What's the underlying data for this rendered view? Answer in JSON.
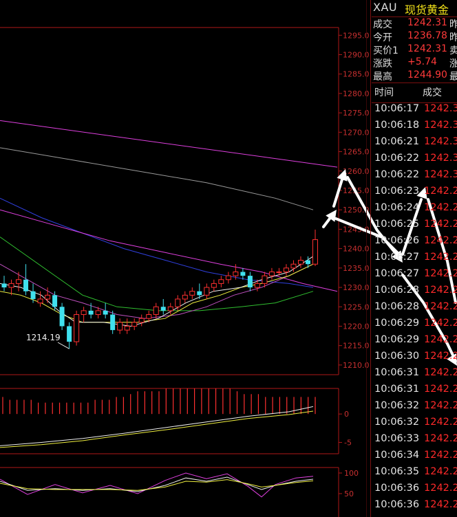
{
  "header": {
    "symbol": "XAU",
    "name": "现货黄金"
  },
  "quote": {
    "rows": [
      {
        "label": "成交",
        "value": "1242.31",
        "ext": "昨",
        "color": "#ff3a3a"
      },
      {
        "label": "今开",
        "value": "1236.78",
        "ext": "昨",
        "color": "#ff3a3a"
      },
      {
        "label": "买价1",
        "value": "1242.31",
        "ext": "卖",
        "color": "#ff3a3a"
      },
      {
        "label": "涨跌",
        "value": "+5.74",
        "ext": "涨",
        "color": "#ff3a3a"
      },
      {
        "label": "最高",
        "value": "1244.90",
        "ext": "最",
        "color": "#ff3a3a"
      }
    ]
  },
  "ticks": {
    "header_time": "时间",
    "header_price": "成交",
    "rows": [
      {
        "time": "10:06:17",
        "price": "1242.3"
      },
      {
        "time": "10:06:18",
        "price": "1242.3"
      },
      {
        "time": "10:06:21",
        "price": "1242.3"
      },
      {
        "time": "10:06:22",
        "price": "1242.3"
      },
      {
        "time": "10:06:22",
        "price": "1242.3"
      },
      {
        "time": "10:06:23",
        "price": "1242.2"
      },
      {
        "time": "10:06:24",
        "price": "1242.2"
      },
      {
        "time": "10:06:25",
        "price": "1242.2"
      },
      {
        "time": "10:06:26",
        "price": "1242.2"
      },
      {
        "time": "10:06:27",
        "price": "1242.2"
      },
      {
        "time": "10:06:27",
        "price": "1242.2"
      },
      {
        "time": "10:06:28",
        "price": "1242.2"
      },
      {
        "time": "10:06:28",
        "price": "1242.2"
      },
      {
        "time": "10:06:29",
        "price": "1242.2"
      },
      {
        "time": "10:06:29",
        "price": "1242.2"
      },
      {
        "time": "10:06:30",
        "price": "1242.2"
      },
      {
        "time": "10:06:31",
        "price": "1242.2"
      },
      {
        "time": "10:06:31",
        "price": "1242.2"
      },
      {
        "time": "10:06:32",
        "price": "1242.2"
      },
      {
        "time": "10:06:32",
        "price": "1242.2"
      },
      {
        "time": "10:06:33",
        "price": "1242.2"
      },
      {
        "time": "10:06:34",
        "price": "1242.2"
      },
      {
        "time": "10:06:35",
        "price": "1242.2"
      },
      {
        "time": "10:06:36",
        "price": "1242.2"
      },
      {
        "time": "10:06:36",
        "price": "1242.2"
      }
    ]
  },
  "chart_data": {
    "type": "candlestick",
    "title": "",
    "price_axis": {
      "ylim": [
        1207.5,
        1297.0
      ],
      "ticks": [
        "1295.0",
        "1290.0",
        "1285.0",
        "1280.0",
        "1275.0",
        "1270.0",
        "1265.0",
        "1260.0",
        "1255.0",
        "1250.0",
        "1245.0",
        "1240.0",
        "1235.0",
        "1230.0",
        "1225.0",
        "1220.0",
        "1215.0",
        "1210.0"
      ]
    },
    "colors": {
      "up": "#ff3030",
      "down": "#40e0ee",
      "axis": "#b01818",
      "label": "#c83030"
    },
    "low_label": "1214.19",
    "candles": [
      {
        "o": 1231,
        "h": 1233,
        "l": 1229,
        "c": 1230
      },
      {
        "o": 1230,
        "h": 1232,
        "l": 1228,
        "c": 1231
      },
      {
        "o": 1231,
        "h": 1234,
        "l": 1229,
        "c": 1232
      },
      {
        "o": 1232,
        "h": 1236,
        "l": 1228,
        "c": 1229
      },
      {
        "o": 1229,
        "h": 1231,
        "l": 1226,
        "c": 1227
      },
      {
        "o": 1226,
        "h": 1229,
        "l": 1225,
        "c": 1227
      },
      {
        "o": 1227,
        "h": 1230,
        "l": 1226,
        "c": 1228
      },
      {
        "o": 1228,
        "h": 1229,
        "l": 1224,
        "c": 1225
      },
      {
        "o": 1225,
        "h": 1226,
        "l": 1219,
        "c": 1220
      },
      {
        "o": 1220,
        "h": 1221,
        "l": 1214.19,
        "c": 1216
      },
      {
        "o": 1216,
        "h": 1224,
        "l": 1215,
        "c": 1223
      },
      {
        "o": 1223,
        "h": 1225,
        "l": 1221,
        "c": 1224
      },
      {
        "o": 1224,
        "h": 1226,
        "l": 1222,
        "c": 1223
      },
      {
        "o": 1223,
        "h": 1225,
        "l": 1222,
        "c": 1224
      },
      {
        "o": 1224,
        "h": 1226,
        "l": 1222,
        "c": 1223
      },
      {
        "o": 1223,
        "h": 1224,
        "l": 1218,
        "c": 1219
      },
      {
        "o": 1219,
        "h": 1222,
        "l": 1218,
        "c": 1221
      },
      {
        "o": 1219,
        "h": 1222,
        "l": 1218,
        "c": 1220
      },
      {
        "o": 1220,
        "h": 1222,
        "l": 1219,
        "c": 1221
      },
      {
        "o": 1221,
        "h": 1223,
        "l": 1220,
        "c": 1222
      },
      {
        "o": 1222,
        "h": 1224,
        "l": 1221,
        "c": 1223
      },
      {
        "o": 1223,
        "h": 1226,
        "l": 1222,
        "c": 1225
      },
      {
        "o": 1225,
        "h": 1227,
        "l": 1223,
        "c": 1224
      },
      {
        "o": 1224,
        "h": 1226,
        "l": 1223,
        "c": 1225
      },
      {
        "o": 1225,
        "h": 1228,
        "l": 1224,
        "c": 1227
      },
      {
        "o": 1227,
        "h": 1229,
        "l": 1226,
        "c": 1228
      },
      {
        "o": 1228,
        "h": 1230,
        "l": 1227,
        "c": 1229
      },
      {
        "o": 1229,
        "h": 1231,
        "l": 1227,
        "c": 1228
      },
      {
        "o": 1228,
        "h": 1231,
        "l": 1227,
        "c": 1230
      },
      {
        "o": 1230,
        "h": 1232,
        "l": 1229,
        "c": 1231
      },
      {
        "o": 1231,
        "h": 1233,
        "l": 1230,
        "c": 1232
      },
      {
        "o": 1232,
        "h": 1234,
        "l": 1231,
        "c": 1233
      },
      {
        "o": 1233,
        "h": 1236,
        "l": 1232,
        "c": 1234
      },
      {
        "o": 1234,
        "h": 1235,
        "l": 1232,
        "c": 1233
      },
      {
        "o": 1233,
        "h": 1234,
        "l": 1229,
        "c": 1230
      },
      {
        "o": 1230,
        "h": 1232,
        "l": 1229,
        "c": 1231
      },
      {
        "o": 1231,
        "h": 1234,
        "l": 1230,
        "c": 1233
      },
      {
        "o": 1233,
        "h": 1235,
        "l": 1232,
        "c": 1234
      },
      {
        "o": 1234,
        "h": 1235,
        "l": 1233,
        "c": 1234
      },
      {
        "o": 1234,
        "h": 1236,
        "l": 1233,
        "c": 1235
      },
      {
        "o": 1235,
        "h": 1237,
        "l": 1234,
        "c": 1236
      },
      {
        "o": 1236,
        "h": 1238,
        "l": 1235,
        "c": 1237
      },
      {
        "o": 1237,
        "h": 1238,
        "l": 1235,
        "c": 1236
      },
      {
        "o": 1236,
        "h": 1244.9,
        "l": 1235.5,
        "c": 1242.31
      }
    ],
    "ma_lines": [
      {
        "name": "ma-magenta-long",
        "color": "#e040e0",
        "points": [
          [
            0,
            1273
          ],
          [
            490,
            1261
          ]
        ]
      },
      {
        "name": "ma-gray",
        "color": "#9a9a9a",
        "points": [
          [
            0,
            1266
          ],
          [
            100,
            1263
          ],
          [
            200,
            1260
          ],
          [
            300,
            1257
          ],
          [
            400,
            1253
          ],
          [
            455,
            1250
          ]
        ]
      },
      {
        "name": "ma-blue",
        "color": "#3040e0",
        "points": [
          [
            0,
            1253
          ],
          [
            60,
            1248
          ],
          [
            120,
            1244
          ],
          [
            180,
            1240
          ],
          [
            240,
            1237
          ],
          [
            300,
            1234
          ],
          [
            360,
            1232
          ],
          [
            420,
            1231
          ],
          [
            455,
            1230
          ]
        ]
      },
      {
        "name": "ma-magenta-short",
        "color": "#e040e0",
        "points": [
          [
            0,
            1250
          ],
          [
            80,
            1246
          ],
          [
            160,
            1242
          ],
          [
            240,
            1239
          ],
          [
            320,
            1236
          ],
          [
            380,
            1234
          ],
          [
            440,
            1231
          ],
          [
            490,
            1229
          ]
        ]
      },
      {
        "name": "ma-green",
        "color": "#30c030",
        "points": [
          [
            0,
            1243
          ],
          [
            40,
            1238
          ],
          [
            80,
            1233
          ],
          [
            120,
            1228
          ],
          [
            170,
            1225
          ],
          [
            230,
            1224
          ],
          [
            290,
            1224
          ],
          [
            350,
            1225
          ],
          [
            400,
            1226
          ],
          [
            455,
            1229
          ]
        ]
      },
      {
        "name": "ma-purple",
        "color": "#c050c0",
        "points": [
          [
            0,
            1236
          ],
          [
            40,
            1232
          ],
          [
            80,
            1228
          ],
          [
            120,
            1226
          ],
          [
            170,
            1223
          ],
          [
            210,
            1222
          ],
          [
            260,
            1223
          ],
          [
            300,
            1225
          ],
          [
            340,
            1228
          ],
          [
            380,
            1230
          ],
          [
            420,
            1233
          ],
          [
            455,
            1236
          ]
        ]
      },
      {
        "name": "ma-yellow",
        "color": "#f0f040",
        "points": [
          [
            0,
            1229
          ],
          [
            30,
            1228
          ],
          [
            60,
            1226
          ],
          [
            90,
            1223
          ],
          [
            120,
            1221
          ],
          [
            160,
            1221
          ],
          [
            200,
            1221
          ],
          [
            240,
            1222
          ],
          [
            280,
            1226
          ],
          [
            320,
            1228
          ],
          [
            350,
            1230
          ],
          [
            380,
            1231
          ],
          [
            420,
            1233
          ],
          [
            455,
            1236
          ]
        ]
      },
      {
        "name": "ma-white",
        "color": "#f0f0f0",
        "points": [
          [
            0,
            1231
          ],
          [
            30,
            1230
          ],
          [
            60,
            1228
          ],
          [
            85,
            1224
          ],
          [
            110,
            1221
          ],
          [
            150,
            1221
          ],
          [
            190,
            1220
          ],
          [
            230,
            1222
          ],
          [
            270,
            1226
          ],
          [
            310,
            1229
          ],
          [
            350,
            1230
          ],
          [
            380,
            1232
          ],
          [
            420,
            1234
          ],
          [
            455,
            1238
          ]
        ]
      }
    ],
    "macd": {
      "axis_labels": [
        "0",
        "-5"
      ],
      "bar_color": "#ff3030",
      "bars": [
        3,
        2.5,
        2.5,
        2.5,
        2.5,
        2,
        2,
        2,
        2,
        2,
        2,
        2,
        2,
        2.5,
        2.5,
        2.5,
        3,
        3,
        3.5,
        4,
        4,
        4,
        4,
        4.5,
        4.5,
        4.5,
        4.5,
        4.5,
        4.5,
        4.5,
        4.5,
        4.5,
        4.5,
        4,
        3.5,
        3.5,
        3.5,
        3,
        3,
        3,
        3,
        3,
        3,
        3,
        3
      ],
      "lines": [
        {
          "name": "macd-dif",
          "color": "#f0f0f0",
          "points": [
            [
              0,
              -5.6
            ],
            [
              60,
              -5
            ],
            [
              120,
              -4.3
            ],
            [
              180,
              -3.4
            ],
            [
              240,
              -2.4
            ],
            [
              300,
              -1.4
            ],
            [
              360,
              -0.4
            ],
            [
              420,
              0.4
            ],
            [
              455,
              1.3
            ]
          ]
        },
        {
          "name": "macd-dea",
          "color": "#f0f040",
          "points": [
            [
              0,
              -5.9
            ],
            [
              60,
              -5.4
            ],
            [
              120,
              -4.7
            ],
            [
              180,
              -3.7
            ],
            [
              240,
              -2.8
            ],
            [
              300,
              -1.8
            ],
            [
              360,
              -0.8
            ],
            [
              420,
              -0.1
            ],
            [
              455,
              0.5
            ]
          ]
        }
      ]
    },
    "kdj": {
      "axis_labels": [
        "100",
        "50"
      ],
      "lines": [
        {
          "name": "kdj-magenta",
          "color": "#e040e0",
          "points": [
            [
              0,
              85
            ],
            [
              40,
              48
            ],
            [
              80,
              72
            ],
            [
              120,
              52
            ],
            [
              160,
              70
            ],
            [
              200,
              50
            ],
            [
              240,
              82
            ],
            [
              270,
              100
            ],
            [
              300,
              86
            ],
            [
              330,
              98
            ],
            [
              360,
              68
            ],
            [
              380,
              42
            ],
            [
              400,
              72
            ],
            [
              430,
              88
            ],
            [
              455,
              92
            ]
          ]
        },
        {
          "name": "kdj-white",
          "color": "#f0f0f0",
          "points": [
            [
              0,
              80
            ],
            [
              40,
              58
            ],
            [
              80,
              62
            ],
            [
              120,
              58
            ],
            [
              160,
              62
            ],
            [
              200,
              55
            ],
            [
              240,
              70
            ],
            [
              270,
              88
            ],
            [
              300,
              80
            ],
            [
              330,
              90
            ],
            [
              360,
              72
            ],
            [
              380,
              60
            ],
            [
              400,
              70
            ],
            [
              430,
              80
            ],
            [
              455,
              85
            ]
          ]
        },
        {
          "name": "kdj-yellow",
          "color": "#f0f040",
          "points": [
            [
              0,
              75
            ],
            [
              40,
              62
            ],
            [
              80,
              60
            ],
            [
              120,
              60
            ],
            [
              160,
              60
            ],
            [
              200,
              58
            ],
            [
              240,
              66
            ],
            [
              270,
              80
            ],
            [
              300,
              78
            ],
            [
              330,
              84
            ],
            [
              360,
              74
            ],
            [
              380,
              66
            ],
            [
              400,
              70
            ],
            [
              430,
              77
            ],
            [
              455,
              81
            ]
          ]
        }
      ]
    },
    "arrows_color": "#ffffff"
  }
}
